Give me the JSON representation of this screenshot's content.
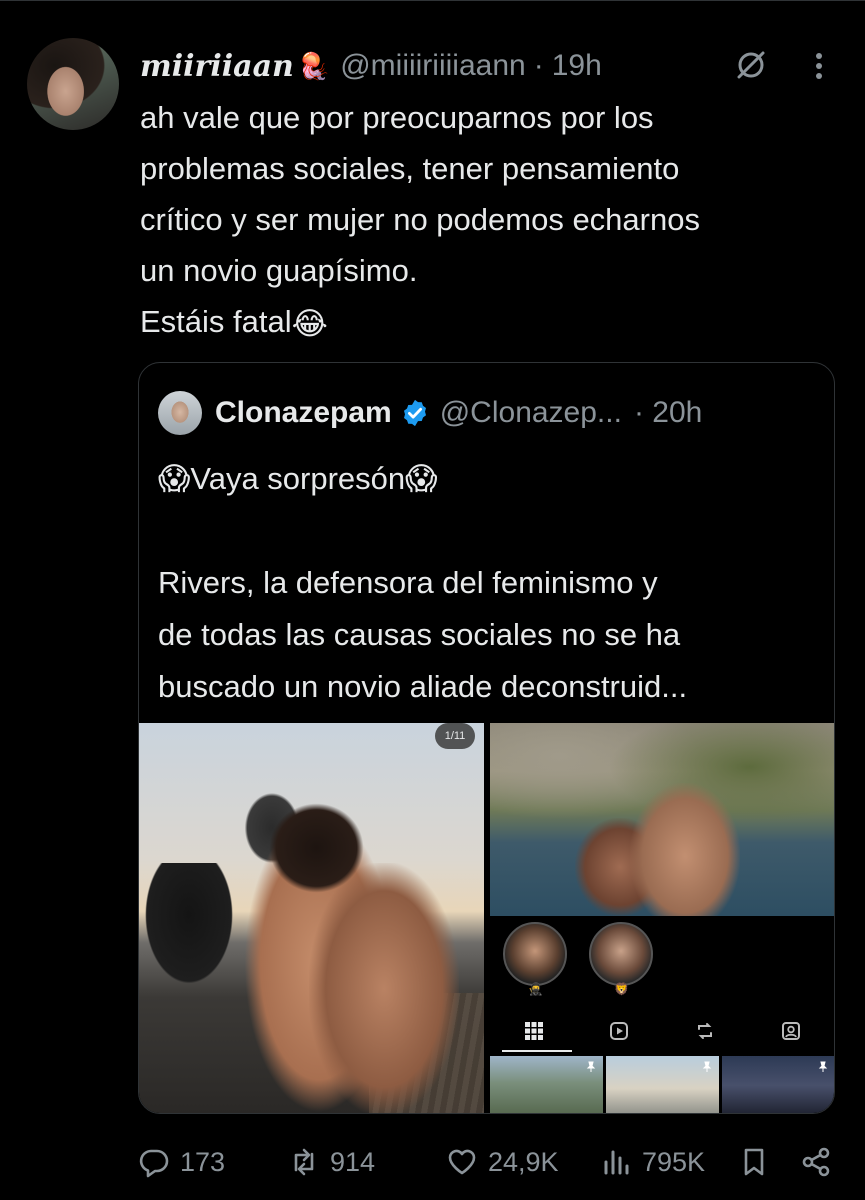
{
  "tweet": {
    "display_name": "miiriiaan",
    "name_emoji": "🪼",
    "handle": "@miiiiriiiiaann",
    "separator": "·",
    "time": "19h",
    "text_lines": [
      "ah vale que por preocuparnos por los",
      "problemas sociales, tener pensamiento",
      "crítico y ser mujer no podemos echarnos",
      "un novio guapísimo.",
      "Estáis fatal"
    ],
    "last_line_emoji": "😂"
  },
  "quote": {
    "display_name": "Clonazepam",
    "handle": "@Clonazep...",
    "separator": "·",
    "time": "20h",
    "line1_emoji_left": "😱",
    "line1_text": "Vaya sorpresón",
    "line1_emoji_right": "😱",
    "text_lines": [
      "Rivers, la defensora del feminismo y",
      "de todas las causas sociales no se ha",
      "buscado un novio aliade deconstruid..."
    ],
    "media": {
      "page_badge": "1/11",
      "story_emojis": [
        "🥷",
        "🦁"
      ]
    }
  },
  "actions": {
    "replies": "173",
    "reposts": "914",
    "likes": "24,9K",
    "views": "795K"
  }
}
